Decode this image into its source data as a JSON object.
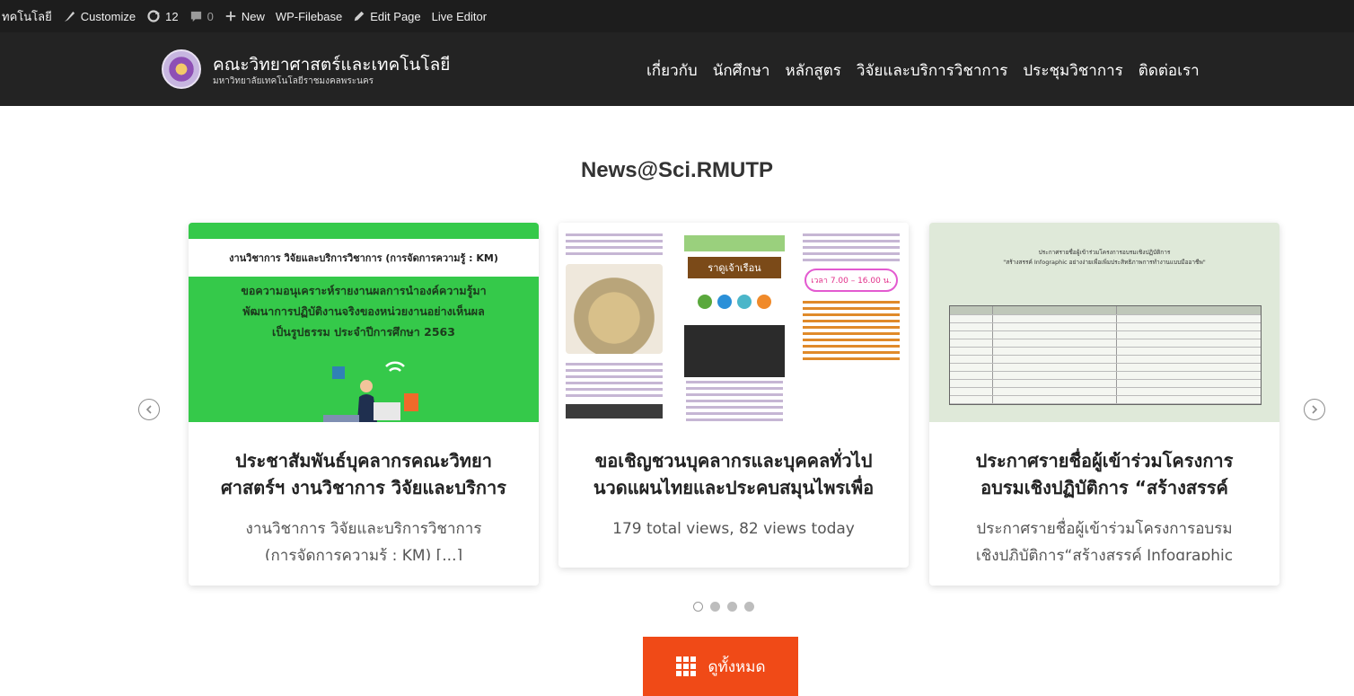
{
  "adminbar": {
    "site_name": "ทคโนโลยี",
    "customize": "Customize",
    "updates": "12",
    "comments": "0",
    "new": "New",
    "filebase": "WP-Filebase",
    "edit_page": "Edit Page",
    "live_editor": "Live Editor"
  },
  "header": {
    "title": "คณะวิทยาศาสตร์และเทคโนโลยี",
    "subtitle": "มหาวิทยาลัยเทคโนโลยีราชมงคลพระนคร",
    "nav": [
      "เกี่ยวกับ",
      "นักศึกษา",
      "หลักสูตร",
      "วิจัยและบริการวิชาการ",
      "ประชุมวิชาการ",
      "ติดต่อเรา"
    ]
  },
  "section": {
    "title": "News@Sci.RMUTP"
  },
  "cards": [
    {
      "img_header": "งานวิชาการ วิจัยและบริการวิชาการ (การจัดการความรู้ : KM)",
      "img_body": [
        "ขอความอนุเคราะห์รายงานผลการนำองค์ความรู้มา",
        "พัฒนาการปฏิบัติงานจริงของหน่วยงานอย่างเห็นผล",
        "เป็นรูปธรรม ประจำปีการศึกษา 2563"
      ],
      "title_line1": "ประชาสัมพันธ์บุคลากรคณะวิทยา",
      "title_line2": "ศาสตร์ฯ งานวิชาการ วิจัยและบริการ",
      "excerpt_line1": "งานวิชาการ วิจัยและบริการวิชาการ",
      "excerpt_line2": "(การจัดการความรู้ : KM) [...]"
    },
    {
      "img_banner": "ราดูเจ้าเรือน",
      "img_time": "เวลา 7.00 – 16.00 น.",
      "title_line1": "ขอเชิญชวนบุคลากรและบุคคลทั่วไป",
      "title_line2": "นวดแผนไทยและประคบสมุนไพรเพื่อ",
      "excerpt_line1": "179 total views,  82 views today"
    },
    {
      "img_heading1": "ประกาศรายชื่อผู้เข้าร่วมโครงการอบรมเชิงปฏิบัติการ",
      "img_heading2": "\"สร้างสรรค์ Infographic อย่างง่ายเพื่อเพิ่มประสิทธิภาพการทำงานแบบมืออาชีพ\"",
      "title_line1": "ประกาศรายชื่อผู้เข้าร่วมโครงการ",
      "title_line2": "อบรมเชิงปฏิบัติการ “สร้างสรรค์",
      "excerpt_line1": "ประกาศรายชื่อผู้เข้าร่วมโครงการอบรม",
      "excerpt_line2": "เชิงปฏิบัติการ“สร้างสรรค์ Infographic"
    }
  ],
  "pagination": {
    "count": 4,
    "active": 0
  },
  "view_all": {
    "label": "ดูทั้งหมด"
  },
  "colors": {
    "accent": "#f04a17",
    "header_bg": "#232323",
    "adminbar_bg": "#1d1d1d",
    "card1_green": "#35c94a"
  }
}
